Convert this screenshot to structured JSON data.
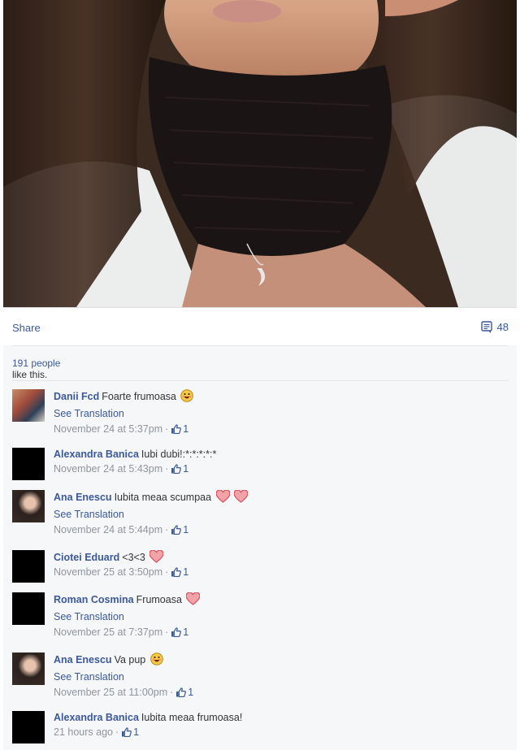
{
  "actions": {
    "share_label": "Share",
    "comment_count": "48"
  },
  "likes": {
    "count_text": "191 people",
    "rest_text": "like this."
  },
  "comments": [
    {
      "author": "Danii Fcd",
      "text": "Foarte frumoasa",
      "emojis": [
        "smile"
      ],
      "see_translation": "See Translation",
      "time": "November 24 at 5:37pm",
      "likes": "1",
      "avatar": "photo"
    },
    {
      "author": "Alexandra Banica",
      "text": "Iubi dubi!:*:*:*:*:*",
      "emojis": [],
      "see_translation": "",
      "time": "November 24 at 5:43pm",
      "likes": "1",
      "avatar": "black"
    },
    {
      "author": "Ana Enescu",
      "text": "Iubita meaa scumpaa",
      "emojis": [
        "heart",
        "heart"
      ],
      "see_translation": "See Translation",
      "time": "November 24 at 5:44pm",
      "likes": "1",
      "avatar": "girl"
    },
    {
      "author": "Ciotei Eduard",
      "text": "<3<3",
      "emojis": [
        "heart"
      ],
      "see_translation": "",
      "time": "November 25 at 3:50pm",
      "likes": "1",
      "avatar": "black"
    },
    {
      "author": "Roman Cosmina",
      "text": "Frumoasa",
      "emojis": [
        "heart"
      ],
      "see_translation": "See Translation",
      "time": "November 25 at 7:37pm",
      "likes": "1",
      "avatar": "black"
    },
    {
      "author": "Ana Enescu",
      "text": "Va pup",
      "emojis": [
        "smile"
      ],
      "see_translation": "See Translation",
      "time": "November 25 at 11:00pm",
      "likes": "1",
      "avatar": "girl"
    },
    {
      "author": "Alexandra Banica",
      "text": "Iubita meaa frumoasa!",
      "emojis": [],
      "see_translation": "",
      "time": "21 hours ago",
      "likes": "1",
      "avatar": "black"
    }
  ],
  "colors": {
    "link": "#3b5998",
    "meta": "#90949c",
    "heart": "#e25563",
    "panel_bg": "#f6f7f9"
  }
}
